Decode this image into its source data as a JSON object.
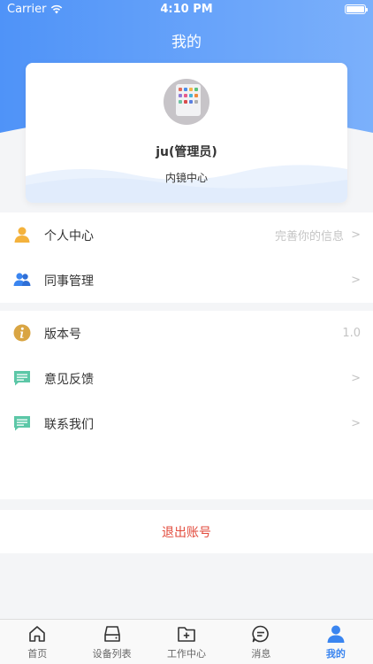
{
  "status_bar": {
    "carrier": "Carrier",
    "time": "4:10 PM"
  },
  "nav": {
    "title": "我的"
  },
  "profile": {
    "name": "ju(管理员)",
    "organization": "内镜中心"
  },
  "menu_group_1": [
    {
      "label": "个人中心",
      "value": "完善你的信息",
      "arrow": ">",
      "icon": "person-icon"
    },
    {
      "label": "同事管理",
      "value": "",
      "arrow": ">",
      "icon": "group-icon"
    }
  ],
  "menu_group_2": [
    {
      "label": "版本号",
      "value": "1.0",
      "arrow": "",
      "icon": "info-icon"
    },
    {
      "label": "意见反馈",
      "value": "",
      "arrow": ">",
      "icon": "message-icon"
    },
    {
      "label": "联系我们",
      "value": "",
      "arrow": ">",
      "icon": "message-icon"
    }
  ],
  "logout": {
    "label": "退出账号"
  },
  "tabs": [
    {
      "label": "首页",
      "icon": "home-icon"
    },
    {
      "label": "设备列表",
      "icon": "device-icon"
    },
    {
      "label": "工作中心",
      "icon": "work-folder-icon"
    },
    {
      "label": "消息",
      "icon": "chat-icon"
    },
    {
      "label": "我的",
      "icon": "profile-icon",
      "active": true
    }
  ],
  "colors": {
    "header_gradient_start": "#4f93f8",
    "header_gradient_end": "#7bb0fb",
    "accent": "#3a85f0",
    "logout_red": "#e24a3b",
    "person_icon": "#f4b23c",
    "group_icon": "#3a85f0",
    "info_icon": "#d9a543",
    "message_icon": "#5cc7a7"
  }
}
